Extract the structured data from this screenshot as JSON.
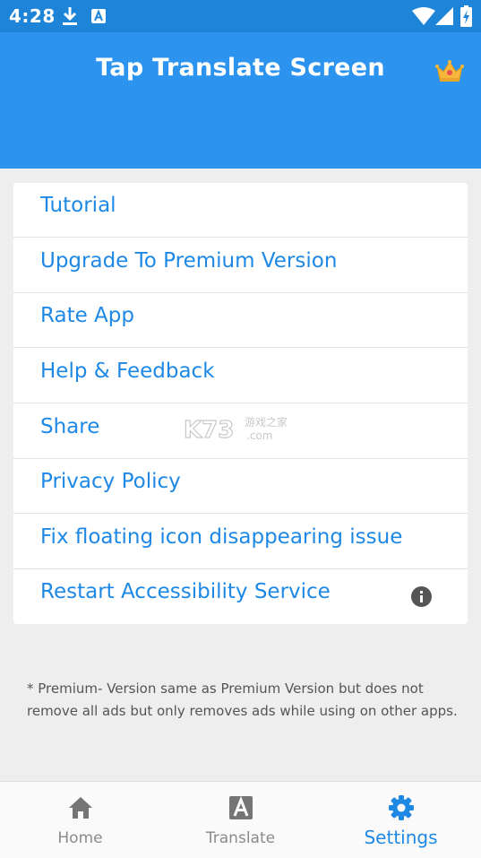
{
  "status_bar": {
    "time": "4:28",
    "icons": [
      "download-icon",
      "a-box-icon",
      "wifi-icon",
      "cell-signal-icon",
      "battery-charging-icon"
    ]
  },
  "app_bar": {
    "title": "Tap Translate Screen",
    "premium_icon": "crown-icon"
  },
  "menu": {
    "items": [
      {
        "label": "Tutorial"
      },
      {
        "label": "Upgrade To Premium Version"
      },
      {
        "label": "Rate App"
      },
      {
        "label": "Help & Feedback"
      },
      {
        "label": "Share"
      },
      {
        "label": "Privacy Policy"
      },
      {
        "label": "Fix floating icon disappearing issue"
      },
      {
        "label": "Restart Accessibility Service",
        "trailing_icon": "info-icon"
      }
    ]
  },
  "watermark": {
    "brand": "K73",
    "chinese": "游戏之家",
    "domain": ".com"
  },
  "note": "* Premium- Version same as Premium Version but does not remove all ads but only removes ads while using on other apps.",
  "bottom_nav": {
    "items": [
      {
        "label": "Home",
        "icon": "home-icon",
        "active": false
      },
      {
        "label": "Translate",
        "icon": "translate-icon",
        "active": false
      },
      {
        "label": "Settings",
        "icon": "gear-icon",
        "active": true
      }
    ]
  },
  "colors": {
    "status_bar": "#1d84d8",
    "app_bar": "#2c94ee",
    "accent": "#1e88e5",
    "background": "#eeeeee"
  }
}
